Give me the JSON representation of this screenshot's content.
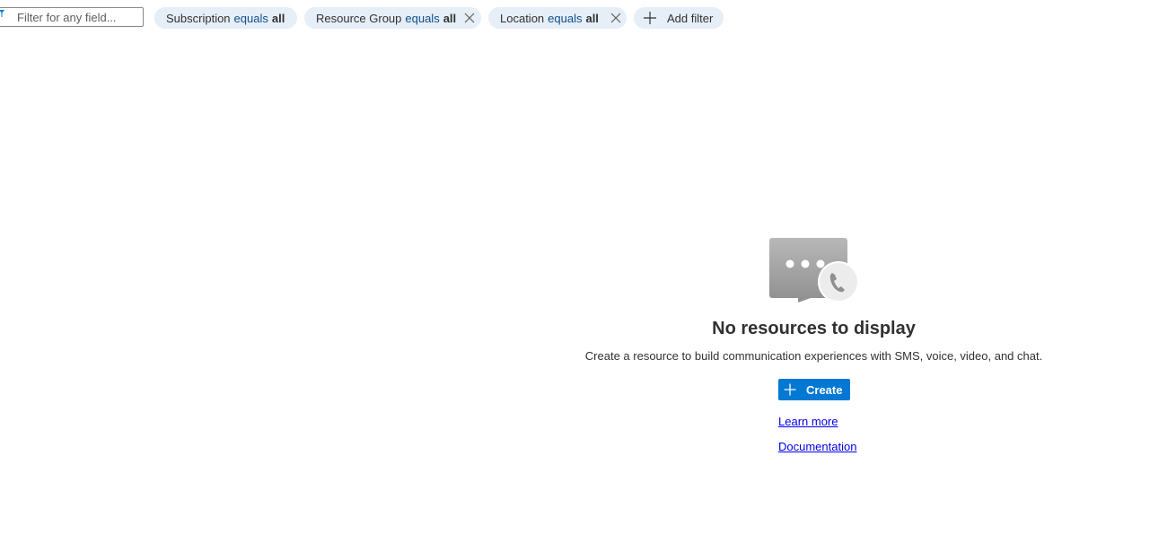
{
  "filter_bar": {
    "search": {
      "placeholder": "Filter for any field...",
      "value": ""
    },
    "pills": [
      {
        "key": "Subscription",
        "operator": "equals",
        "value": "all",
        "removable": false
      },
      {
        "key": "Resource Group",
        "operator": "equals",
        "value": "all",
        "removable": true
      },
      {
        "key": "Location",
        "operator": "equals",
        "value": "all",
        "removable": true
      }
    ],
    "add_filter_label": "Add filter"
  },
  "empty_state": {
    "icon": "chat-phone-icon",
    "title": "No resources to display",
    "description": "Create a resource to build communication experiences with SMS, voice, video, and chat.",
    "create_label": "Create",
    "learn_more_label": "Learn more",
    "documentation_label": "Documentation"
  },
  "colors": {
    "accent": "#0078d4",
    "pill_background": "#e6eef7",
    "link": "#0000ee",
    "text": "#323130"
  }
}
